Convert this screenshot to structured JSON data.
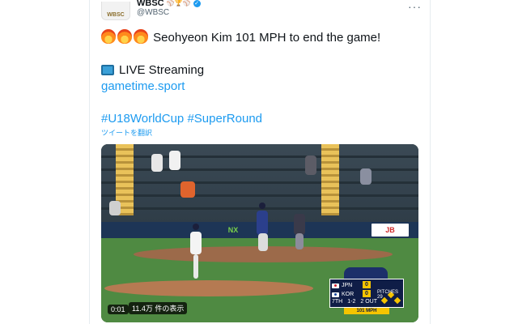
{
  "account": {
    "display_name": "WBSC",
    "handle": "@WBSC",
    "avatar_text": "WBSC",
    "extra_emojis": "⚾🏆⚾"
  },
  "tweet": {
    "line1": "Seohyeon Kim 101 MPH to end the game!",
    "line2": "LIVE Streaming",
    "link": "gametime.sport",
    "hashtags": "#U18WorldCup #SuperRound",
    "translate": "ツイートを翻訳"
  },
  "video": {
    "time": "0:01",
    "views": "11.4万 件の表示",
    "ads": [
      "NX",
      "JB"
    ],
    "scorebug": {
      "team1": "JPN",
      "score1": "0",
      "team2": "KOR",
      "score2": "0",
      "inning": "7TH",
      "count": "1-2",
      "outs": "2 OUT",
      "pitches": "PITCHES 29",
      "speed": "101 MPH"
    }
  },
  "colors": {
    "link": "#1d9bf0",
    "text": "#0f1419",
    "muted": "#536471",
    "verified": "#1d9bf0"
  }
}
